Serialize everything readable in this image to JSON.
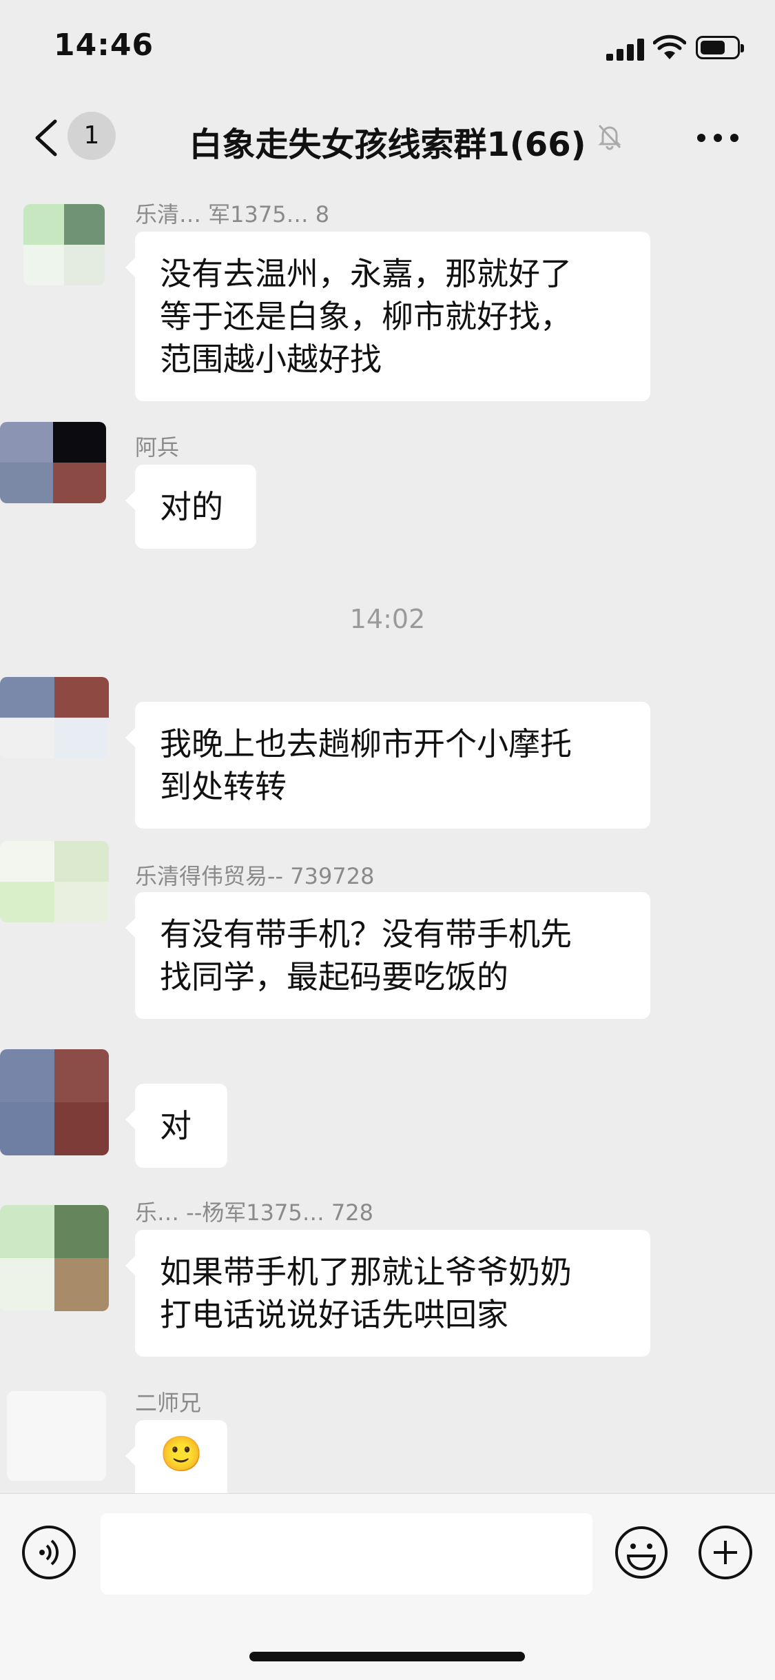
{
  "status_bar": {
    "time": "14:46",
    "battery_level": 0.7
  },
  "nav": {
    "back_icon": "chevron-left-icon",
    "unread_badge": "1",
    "title": "白象走失女孩线索群1(66)",
    "mute_icon": "bell-muted-icon",
    "more_icon": "more-dots-icon"
  },
  "timestamp": "14:02",
  "messages": [
    {
      "sender": "乐清… 军1375… 8",
      "text": "没有去温州，永嘉，那就好了\n等于还是白象，柳市就好找，\n范围越小越好找"
    },
    {
      "sender": "阿兵",
      "text": "对的"
    },
    {
      "sender": "",
      "text": "我晚上也去趟柳市开个小摩托\n到处转转"
    },
    {
      "sender": "乐清得伟贸易-- 739728",
      "text": "有没有带手机？没有带手机先\n找同学，最起码要吃饭的"
    },
    {
      "sender": "",
      "text": "对"
    },
    {
      "sender": "乐… --杨军1375… 728",
      "text": "如果带手机了那就让爷爷奶奶\n打电话说说好话先哄回家"
    },
    {
      "sender": "二师兄",
      "text": "🙂"
    }
  ],
  "input_bar": {
    "voice_icon": "voice-icon",
    "emoji_icon": "emoji-icon",
    "plus_icon": "plus-icon"
  }
}
